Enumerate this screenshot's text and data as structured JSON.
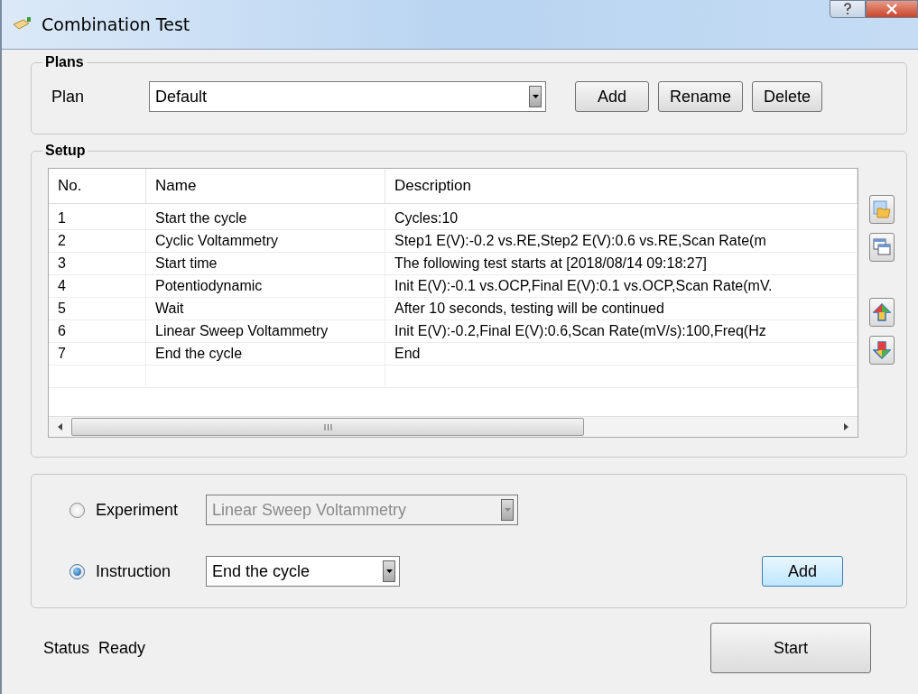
{
  "window": {
    "title": "Combination Test"
  },
  "plans": {
    "legend": "Plans",
    "label": "Plan",
    "value": "Default",
    "buttons": [
      "Add",
      "Rename",
      "Delete"
    ]
  },
  "setup": {
    "legend": "Setup",
    "columns": [
      "No.",
      "Name",
      "Description"
    ],
    "rows": [
      {
        "no": "1",
        "name": "Start the cycle",
        "description": "Cycles:10"
      },
      {
        "no": "2",
        "name": "Cyclic Voltammetry",
        "description": "Step1 E(V):-0.2 vs.RE,Step2 E(V):0.6 vs.RE,Scan Rate(m"
      },
      {
        "no": "3",
        "name": "Start time",
        "description": "The following test starts at [2018/08/14 09:18:27]"
      },
      {
        "no": "4",
        "name": "Potentiodynamic",
        "description": "Init E(V):-0.1 vs.OCP,Final E(V):0.1 vs.OCP,Scan Rate(mV."
      },
      {
        "no": "5",
        "name": "Wait",
        "description": "After 10 seconds, testing will be continued"
      },
      {
        "no": "6",
        "name": "Linear Sweep Voltammetry",
        "description": "Init E(V):-0.2,Final E(V):0.6,Scan Rate(mV/s):100,Freq(Hz"
      },
      {
        "no": "7",
        "name": "End the cycle",
        "description": "End"
      }
    ]
  },
  "add_step": {
    "options": [
      {
        "label": "Experiment",
        "selected": false,
        "value": "Linear Sweep Voltammetry",
        "disabled": true
      },
      {
        "label": "Instruction",
        "selected": true,
        "value": "End the cycle",
        "disabled": false
      }
    ],
    "button": "Add"
  },
  "status": {
    "label": "Status",
    "value": "Ready"
  },
  "start_button": "Start"
}
